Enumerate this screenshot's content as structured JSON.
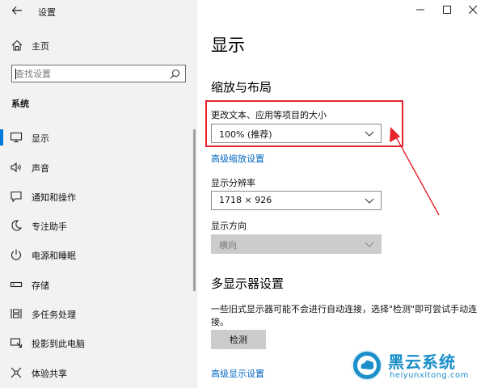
{
  "window": {
    "app_title": "设置",
    "back_icon": "back-arrow-icon",
    "minimize_glyph": "—",
    "maximize_glyph": "☐",
    "close_glyph": "✕"
  },
  "sidebar": {
    "home_label": "主页",
    "search": {
      "placeholder": "查找设置",
      "value": ""
    },
    "section_label": "系统",
    "items": [
      {
        "label": "显示",
        "icon": "monitor-icon",
        "active": true
      },
      {
        "label": "声音",
        "icon": "speaker-icon",
        "active": false
      },
      {
        "label": "通知和操作",
        "icon": "notification-icon",
        "active": false
      },
      {
        "label": "专注助手",
        "icon": "moon-icon",
        "active": false
      },
      {
        "label": "电源和睡眠",
        "icon": "power-icon",
        "active": false
      },
      {
        "label": "存储",
        "icon": "storage-icon",
        "active": false
      },
      {
        "label": "多任务处理",
        "icon": "multitask-icon",
        "active": false
      },
      {
        "label": "投影到此电脑",
        "icon": "project-icon",
        "active": false
      },
      {
        "label": "体验共享",
        "icon": "share-icon",
        "active": false
      }
    ]
  },
  "main": {
    "page_title": "显示",
    "scale_heading": "缩放与布局",
    "scale_label": "更改文本、应用等项目的大小",
    "scale_value": "100% (推荐)",
    "advanced_scaling_link": "高级缩放设置",
    "resolution_label": "显示分辨率",
    "resolution_value": "1718 × 926",
    "orientation_label": "显示方向",
    "orientation_value": "横向",
    "multi_heading": "多显示器设置",
    "multi_desc": "一些旧式显示器可能不会进行自动连接，选择\"检测\"即可尝试手动连接。",
    "detect_button": "检测",
    "advanced_display_link": "高级显示设置"
  },
  "watermark": {
    "name": "黑云系统",
    "url": "heiyunxitong.com"
  },
  "colors": {
    "accent": "#0078d7",
    "link": "#0067c0",
    "annotation": "#e8232b",
    "watermark": "#1a8fc9"
  }
}
